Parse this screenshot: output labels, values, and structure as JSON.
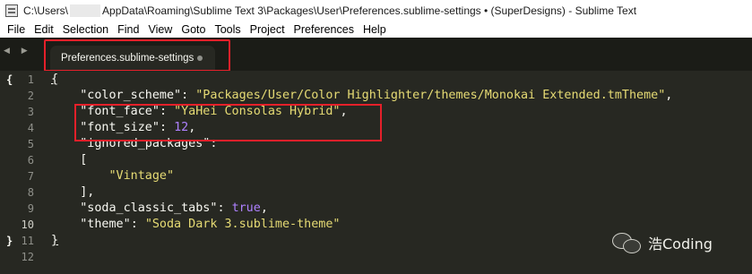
{
  "window": {
    "title_prefix": "C:\\Users\\",
    "title_suffix": "AppData\\Roaming\\Sublime Text 3\\Packages\\User\\Preferences.sublime-settings • (SuperDesigns) - Sublime Text"
  },
  "menu": [
    "File",
    "Edit",
    "Selection",
    "Find",
    "View",
    "Goto",
    "Tools",
    "Project",
    "Preferences",
    "Help"
  ],
  "tab_nav": "◀ ▶",
  "tab": {
    "label": "Preferences.sublime-settings",
    "modified": true
  },
  "editor": {
    "line_numbers": [
      "1",
      "2",
      "3",
      "4",
      "5",
      "6",
      "7",
      "8",
      "9",
      "10",
      "11",
      "12"
    ],
    "fold_markers": {
      "line1": "{",
      "line11": "}"
    },
    "lines": [
      {
        "num": "1",
        "indent": "",
        "text": "{"
      },
      {
        "num": "2",
        "key": "\"color_scheme\"",
        "value": "\"Packages/User/Color Highlighter/themes/Monokai Extended.tmTheme\""
      },
      {
        "num": "3",
        "key": "\"font_face\"",
        "value": "\"YaHei Consolas Hybrid\""
      },
      {
        "num": "4",
        "key": "\"font_size\"",
        "value": "12"
      },
      {
        "num": "5",
        "key": "\"ignored_packages\""
      },
      {
        "num": "6",
        "text": "["
      },
      {
        "num": "7",
        "value": "\"Vintage\""
      },
      {
        "num": "8",
        "text": "],"
      },
      {
        "num": "9",
        "key": "\"soda_classic_tabs\"",
        "value": "true"
      },
      {
        "num": "10",
        "key": "\"theme\"",
        "value": "\"Soda Dark 3.sublime-theme\""
      },
      {
        "num": "11",
        "text": "}"
      },
      {
        "num": "12",
        "text": ""
      }
    ]
  },
  "watermark": {
    "text": "浩Coding",
    "icon": "wechat-icon"
  },
  "colors": {
    "background": "#272822",
    "string": "#e6db74",
    "number": "#ae81ff",
    "highlight_box": "#e5202a"
  }
}
